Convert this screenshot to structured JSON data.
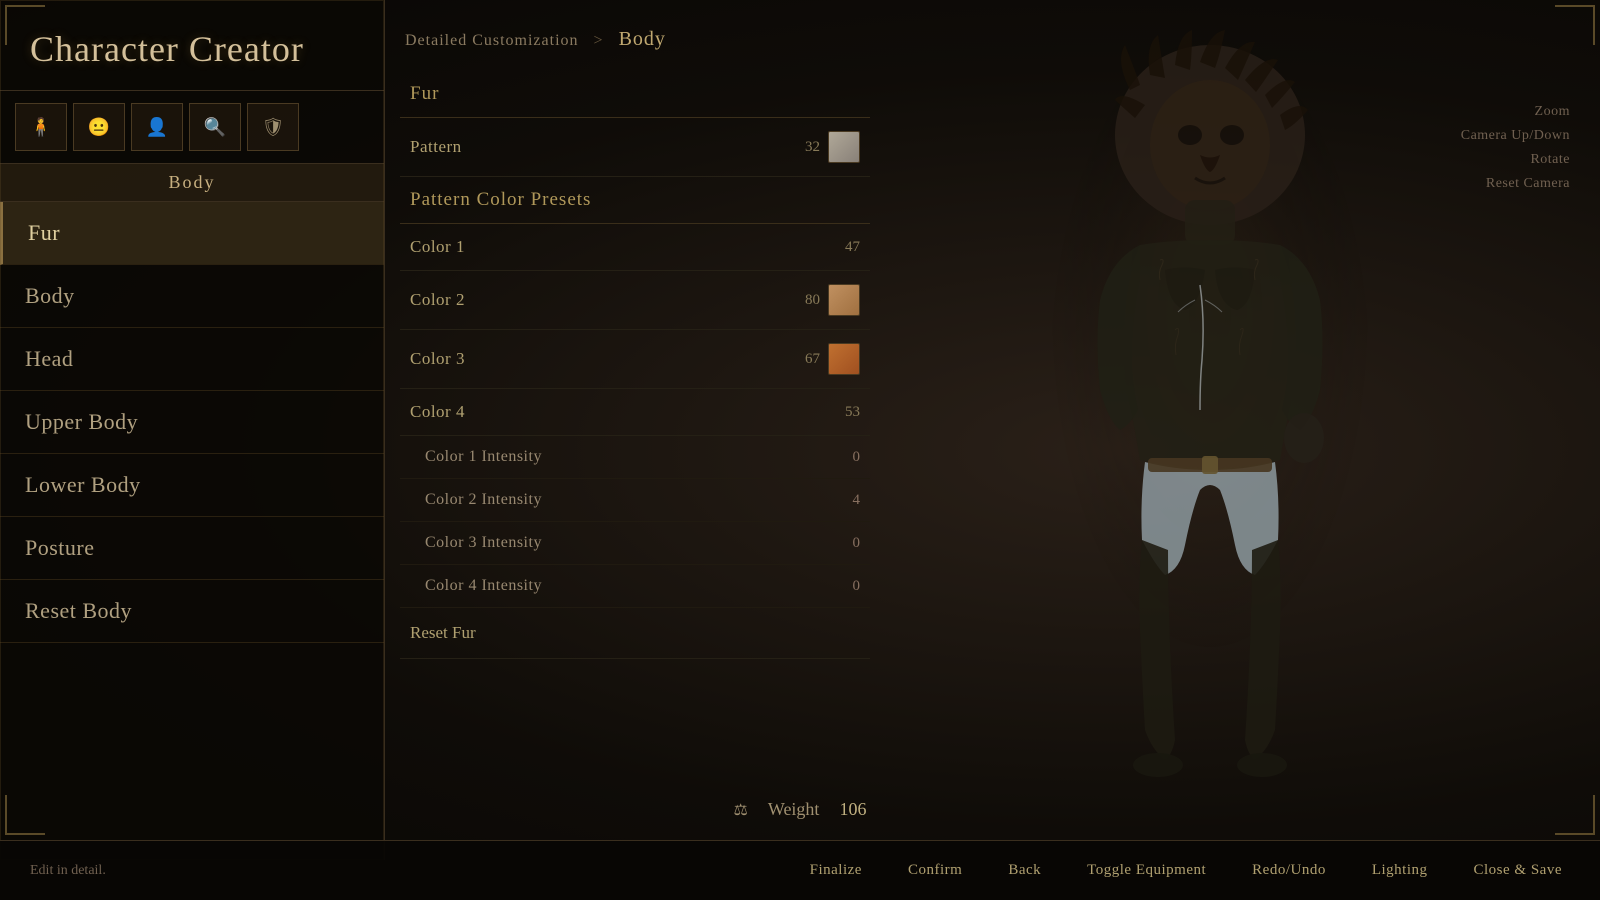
{
  "app": {
    "title": "Character Creator"
  },
  "breadcrumb": {
    "parent": "Detailed Customization",
    "separator": ">",
    "current": "Body"
  },
  "tabs": {
    "icons": [
      "🧍",
      "😐",
      "👤",
      "🔍",
      "🛡"
    ],
    "body_label": "Body"
  },
  "sidebar": {
    "nav_items": [
      {
        "label": "Fur",
        "active": true
      },
      {
        "label": "Body",
        "active": false
      },
      {
        "label": "Head",
        "active": false
      },
      {
        "label": "Upper Body",
        "active": false
      },
      {
        "label": "Lower Body",
        "active": false
      },
      {
        "label": "Posture",
        "active": false
      },
      {
        "label": "Reset Body",
        "active": false
      }
    ]
  },
  "main": {
    "section_label": "Fur",
    "pattern_label": "Pattern",
    "pattern_value": "32",
    "pattern_color_presets_label": "Pattern Color Presets",
    "colors": [
      {
        "label": "Color 1",
        "value": "47",
        "swatch": "gray"
      },
      {
        "label": "Color 2",
        "value": "80",
        "swatch": "warm"
      },
      {
        "label": "Color 3",
        "value": "67",
        "swatch": "orange"
      },
      {
        "label": "Color 4",
        "value": "53",
        "swatch": "none"
      }
    ],
    "intensities": [
      {
        "label": "Color 1 Intensity",
        "value": "0"
      },
      {
        "label": "Color 2 Intensity",
        "value": "4"
      },
      {
        "label": "Color 3 Intensity",
        "value": "0"
      },
      {
        "label": "Color 4 Intensity",
        "value": "0"
      }
    ],
    "reset_fur_label": "Reset Fur"
  },
  "camera_hints": [
    {
      "label": "Zoom"
    },
    {
      "label": "Camera Up/Down"
    },
    {
      "label": "Rotate"
    },
    {
      "label": "Reset Camera"
    }
  ],
  "weight": {
    "icon": "⚖",
    "label": "Weight",
    "value": "106"
  },
  "bottom_bar": {
    "hint": "Edit in detail.",
    "buttons": [
      {
        "label": "Finalize"
      },
      {
        "label": "Confirm"
      },
      {
        "label": "Back"
      },
      {
        "label": "Toggle Equipment"
      },
      {
        "label": "Redo/Undo"
      },
      {
        "label": "Lighting"
      },
      {
        "label": "Close & Save"
      }
    ]
  }
}
